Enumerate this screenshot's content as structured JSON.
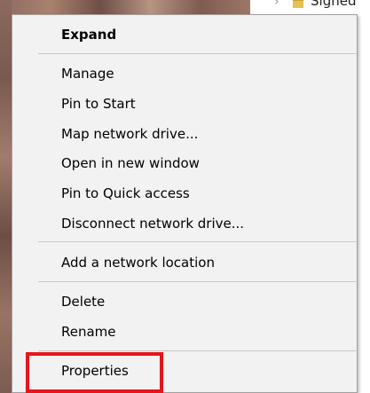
{
  "explorer_nav": {
    "visible_item_text": "Signed"
  },
  "context_menu": {
    "groups": [
      [
        {
          "id": "expand",
          "label": "Expand",
          "bold": true
        }
      ],
      [
        {
          "id": "manage",
          "label": "Manage"
        },
        {
          "id": "pin-to-start",
          "label": "Pin to Start"
        },
        {
          "id": "map-network-drive",
          "label": "Map network drive..."
        },
        {
          "id": "open-in-new-window",
          "label": "Open in new window"
        },
        {
          "id": "pin-to-quick-access",
          "label": "Pin to Quick access"
        },
        {
          "id": "disconnect-network-drive",
          "label": "Disconnect network drive..."
        }
      ],
      [
        {
          "id": "add-network-location",
          "label": "Add a network location"
        }
      ],
      [
        {
          "id": "delete",
          "label": "Delete"
        },
        {
          "id": "rename",
          "label": "Rename"
        }
      ],
      [
        {
          "id": "properties",
          "label": "Properties"
        }
      ]
    ],
    "highlighted_item": "properties",
    "highlight_color": "#e8141b",
    "menu_background": "#f2f2f2"
  }
}
